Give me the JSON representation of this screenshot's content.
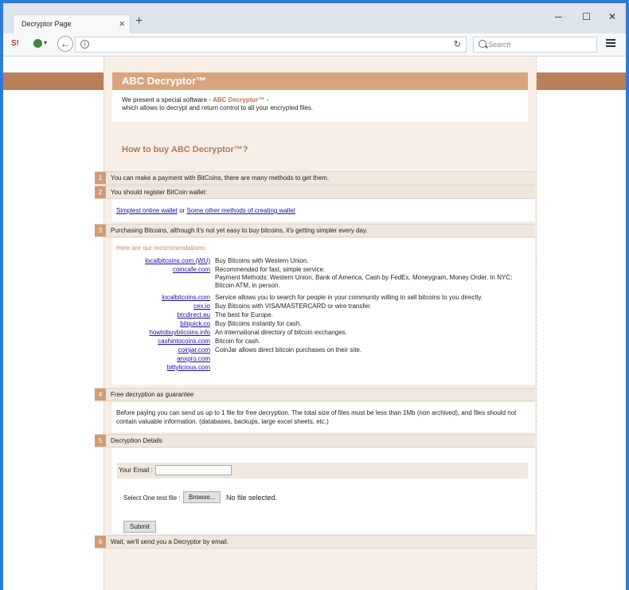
{
  "browser": {
    "tab_title": "Decryptor Page",
    "search_placeholder": "Search"
  },
  "page": {
    "title": "ABC Decryptor™",
    "intro_prefix": "We present a special software - ",
    "intro_brand": "ABC Decryptor™",
    "intro_suffix": " -",
    "intro_line2": "which allows to decrypt and return control to all your encrypted files.",
    "howto_title": "How to buy ABC Decryptor™?",
    "steps": [
      {
        "num": "1",
        "text": "You can make a payment with BitCoins, there are many methods to get them."
      },
      {
        "num": "2",
        "text": "You should register BitCoin wallet:"
      },
      {
        "num": "3",
        "text": "Purchasing Bitcoins, although it's not yet easy to buy bitcoins, it's getting simpler every day."
      },
      {
        "num": "4",
        "text": "Free decryption as guarantee"
      },
      {
        "num": "5",
        "text": "Decryption Details"
      },
      {
        "num": "6",
        "text": "Wait, we'll send you a Decryptor by email."
      }
    ],
    "wallet": {
      "link1": "Simplest online wallet",
      "or": " or ",
      "link2": "Some other methods of creating wallet"
    },
    "recommendations_title": "Here are our recommendations:",
    "recommendations": [
      {
        "name": "localbitcoins.com (WU)",
        "desc": "Buy Bitcoins with Western Union."
      },
      {
        "name": "coincafe.com",
        "desc": "Recommended for fast, simple service.\nPayment Methods: Western Union, Bank of America, Cash by FedEx, Moneygram, Money Order. In NYC: Bitcoin ATM, in person."
      },
      {
        "name": "localbitcoins.com",
        "desc": "Service allows you to search for people in your community willing to sell bitcoins to you directly."
      },
      {
        "name": "cex.io",
        "desc": "Buy Bitcoins with VISA/MASTERCARD or wire transfer."
      },
      {
        "name": "btcdirect.eu",
        "desc": "The best for Europe."
      },
      {
        "name": "bitquick.co",
        "desc": "Buy Bitcoins instantly for cash."
      },
      {
        "name": "howtobuybitcoins.info",
        "desc": "An international directory of bitcoin exchanges."
      },
      {
        "name": "cashintocoins.com",
        "desc": "Bitcoin for cash."
      },
      {
        "name": "coinjar.com",
        "desc": "CoinJar allows direct bitcoin purchases on their site."
      },
      {
        "name": "anxpro.com",
        "desc": ""
      },
      {
        "name": "bittylicious.com",
        "desc": ""
      }
    ],
    "free_decrypt_text": "Before paying you can send us up to 1 file for free decryption. The total size of files must be less than 1Mb (non archived), and files should not contain valuable information. (databases, backups, large excel sheets, etc.)",
    "form": {
      "email_label": "Your Email :",
      "email_value": "",
      "file_label": "Select One test file :",
      "browse_label": "Browse...",
      "no_file": "No file selected.",
      "submit_label": "Submit"
    }
  }
}
